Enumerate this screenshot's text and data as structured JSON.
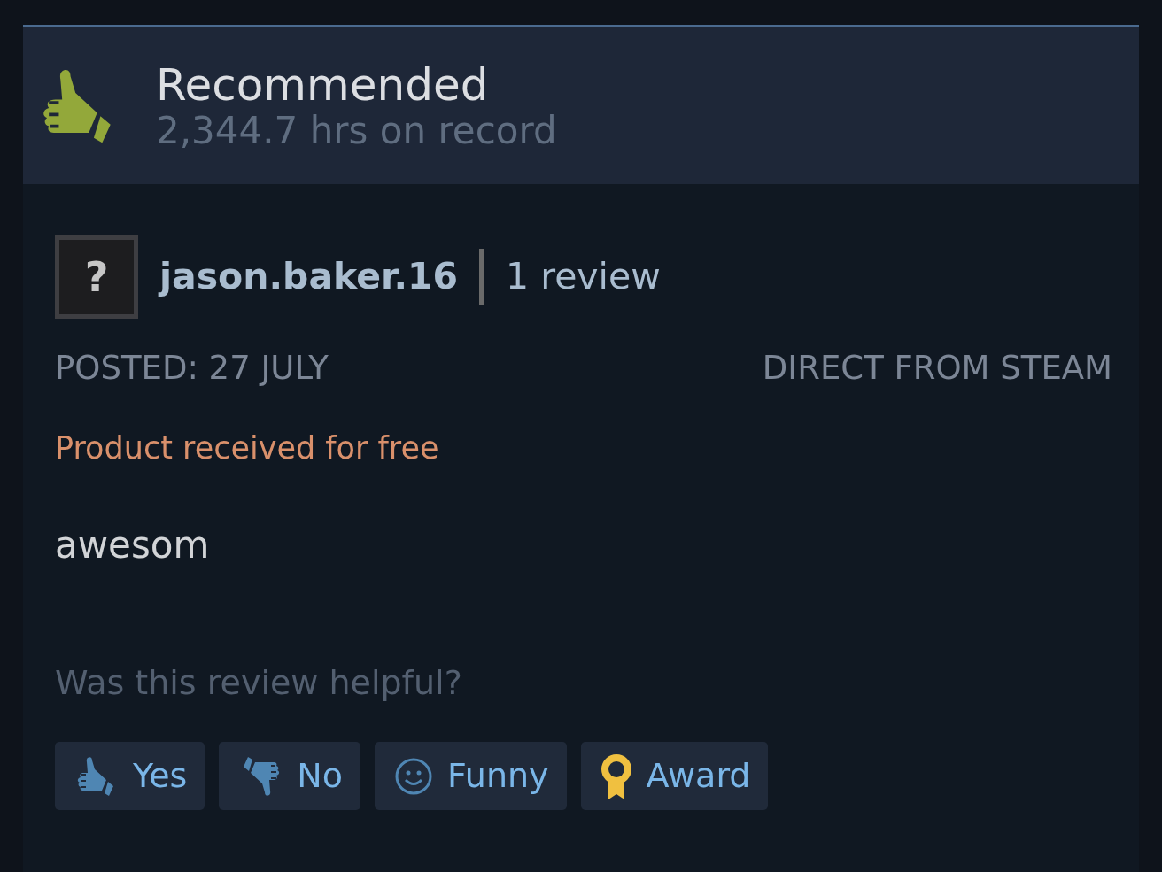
{
  "review": {
    "verdict": "Recommended",
    "recommended": true,
    "hours": "2,344.7 hrs on record"
  },
  "author": {
    "avatar": "?",
    "name": "jason.baker.16",
    "review_count": "1 review"
  },
  "posted": "POSTED: 27 JULY",
  "source": "DIRECT FROM STEAM",
  "notice": "Product received for free",
  "body": "awesom",
  "helpful_prompt": "Was this review helpful?",
  "buttons": [
    {
      "label": "Yes",
      "kind": "thumbs_up"
    },
    {
      "label": "No",
      "kind": "thumbs_down"
    },
    {
      "label": "Funny",
      "kind": "smiley"
    },
    {
      "label": "Award",
      "kind": "award"
    }
  ]
}
